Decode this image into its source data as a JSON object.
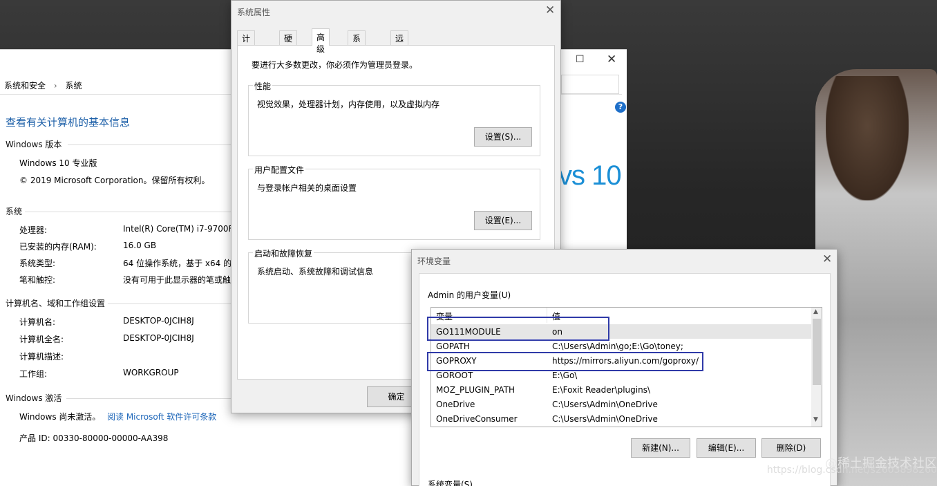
{
  "sys_window": {
    "breadcrumb": [
      "系统和安全",
      "系统"
    ],
    "title": "查看有关计算机的基本信息",
    "logo_text": "vs 10",
    "windows_edition": {
      "heading": "Windows 版本",
      "edition": "Windows 10 专业版",
      "copyright": "© 2019 Microsoft Corporation。保留所有权利。"
    },
    "system": {
      "heading": "系统",
      "rows": [
        {
          "label": "处理器:",
          "value": "Intel(R) Core(TM) i7-9700F"
        },
        {
          "label": "已安装的内存(RAM):",
          "value": "16.0 GB"
        },
        {
          "label": "系统类型:",
          "value": "64 位操作系统，基于 x64 的"
        },
        {
          "label": "笔和触控:",
          "value": "没有可用于此显示器的笔或触"
        }
      ]
    },
    "computer_name": {
      "heading": "计算机名、域和工作组设置",
      "rows": [
        {
          "label": "计算机名:",
          "value": "DESKTOP-0JCIH8J"
        },
        {
          "label": "计算机全名:",
          "value": "DESKTOP-0JCIH8J"
        },
        {
          "label": "计算机描述:",
          "value": ""
        },
        {
          "label": "工作组:",
          "value": "WORKGROUP"
        }
      ]
    },
    "activation": {
      "heading": "Windows 激活",
      "status": "Windows 尚未激活。",
      "link": "阅读 Microsoft 软件许可条款",
      "product_id": "产品 ID: 00330-80000-00000-AA398"
    }
  },
  "props_dialog": {
    "title": "系统属性",
    "tabs": [
      "计算机名",
      "硬件",
      "高级",
      "系统保护",
      "远程"
    ],
    "active_tab": "高级",
    "admin_note": "要进行大多数更改，你必须作为管理员登录。",
    "performance": {
      "label": "性能",
      "desc": "视觉效果，处理器计划，内存使用，以及虚拟内存",
      "button": "设置(S)..."
    },
    "profiles": {
      "label": "用户配置文件",
      "desc": "与登录帐户相关的桌面设置",
      "button": "设置(E)..."
    },
    "startup": {
      "label": "启动和故障恢复",
      "desc": "系统启动、系统故障和调试信息"
    },
    "ok_button": "确定"
  },
  "env_dialog": {
    "title": "环境变量",
    "user_vars_label": "Admin 的用户变量(U)",
    "columns": [
      "变量",
      "值"
    ],
    "rows": [
      {
        "name": "GO111MODULE",
        "value": "on"
      },
      {
        "name": "GOPATH",
        "value": "C:\\Users\\Admin\\go;E:\\Go\\toney;"
      },
      {
        "name": "GOPROXY",
        "value": "https://mirrors.aliyun.com/goproxy/"
      },
      {
        "name": "GOROOT",
        "value": "E:\\Go\\"
      },
      {
        "name": "MOZ_PLUGIN_PATH",
        "value": "E:\\Foxit Reader\\plugins\\"
      },
      {
        "name": "OneDrive",
        "value": "C:\\Users\\Admin\\OneDrive"
      },
      {
        "name": "OneDriveConsumer",
        "value": "C:\\Users\\Admin\\OneDrive"
      }
    ],
    "buttons": {
      "new": "新建(N)...",
      "edit": "编辑(E)...",
      "delete": "删除(D)"
    },
    "sys_vars_label": "系统变量(S)"
  },
  "watermark": {
    "community": "@稀土掘金技术社区",
    "url": "https://blog.csdn.net/s2603898260"
  },
  "colors": {
    "highlight_box": "#2f3aa8",
    "link": "#1a64b8",
    "title_blue": "#1c5fa8"
  }
}
